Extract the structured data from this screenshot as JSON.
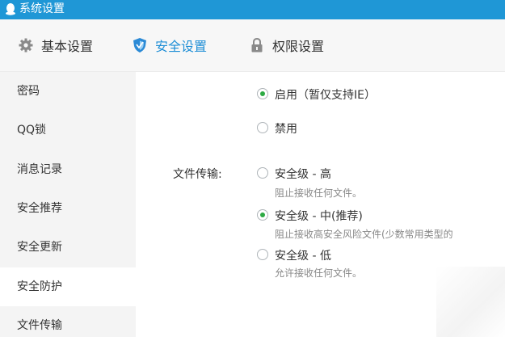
{
  "window": {
    "title": "系统设置",
    "accent": "#1f97d6"
  },
  "tabs": [
    {
      "label": "基本设置",
      "icon": "gear-icon",
      "active": false
    },
    {
      "label": "安全设置",
      "icon": "shield-icon",
      "active": true
    },
    {
      "label": "权限设置",
      "icon": "lock-icon",
      "active": false
    }
  ],
  "sidebar": {
    "items": [
      {
        "label": "密码"
      },
      {
        "label": "QQ锁"
      },
      {
        "label": "消息记录"
      },
      {
        "label": "安全推荐"
      },
      {
        "label": "安全更新"
      },
      {
        "label": "安全防护",
        "active": true
      },
      {
        "label": "文件传输"
      }
    ]
  },
  "protection": {
    "enable_label": "启用（暂仅支持IE）",
    "enable_checked": true,
    "disable_label": "禁用",
    "disable_checked": false
  },
  "file_transfer": {
    "section_label": "文件传输:",
    "options": [
      {
        "label": "安全级 - 高",
        "desc": "阻止接收任何文件。",
        "checked": false
      },
      {
        "label": "安全级 - 中(推荐)",
        "desc": "阻止接收高安全风险文件(少数常用类型的",
        "checked": true
      },
      {
        "label": "安全级 - 低",
        "desc": "允许接收任何文件。",
        "checked": false
      }
    ]
  }
}
